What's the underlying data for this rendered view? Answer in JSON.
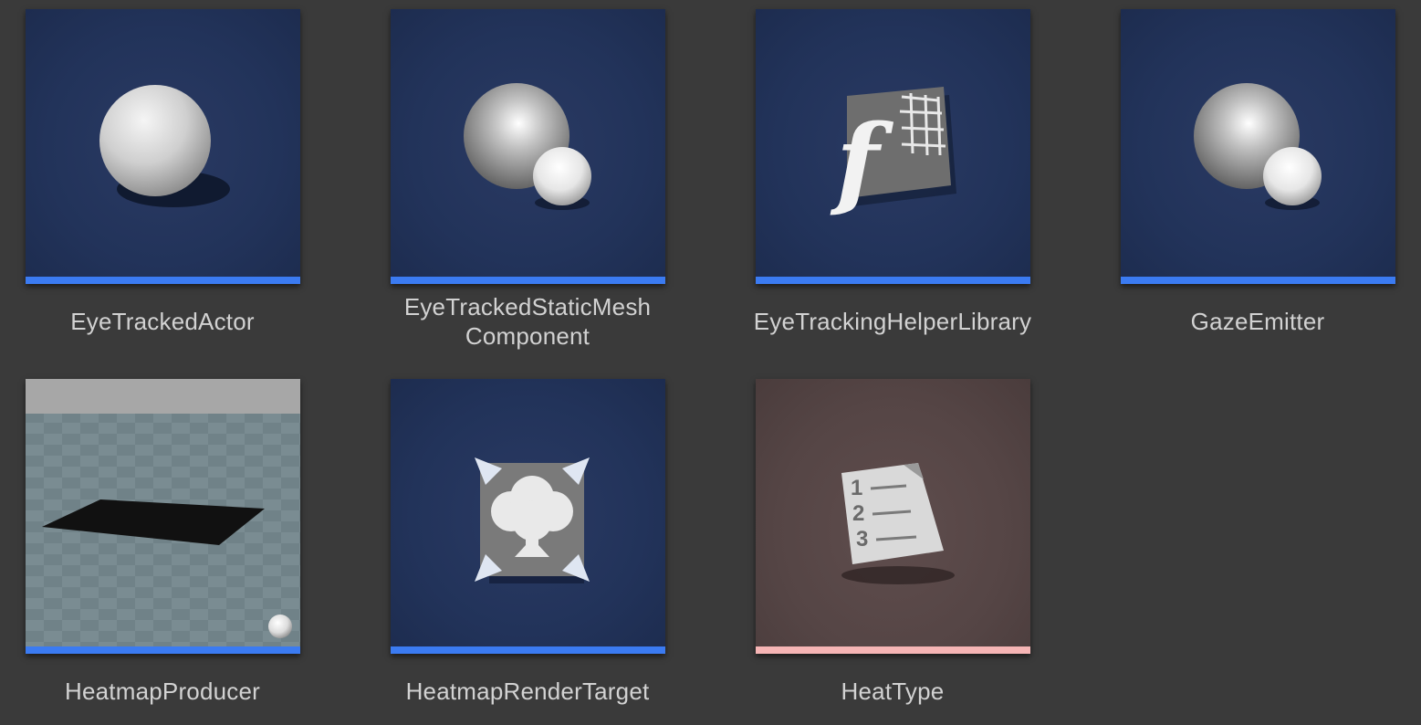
{
  "assets": [
    {
      "name": "EyeTrackedActor",
      "icon": "sphere-actor-icon",
      "type_color": "#3b7bf2",
      "thumb": "blue"
    },
    {
      "name_line1": "EyeTrackedStaticMesh",
      "name_line2": "Component",
      "icon": "component-spheres-icon",
      "type_color": "#3b7bf2",
      "thumb": "blue"
    },
    {
      "name": "EyeTrackingHelperLibrary",
      "icon": "function-library-icon",
      "type_color": "#3b7bf2",
      "thumb": "blue"
    },
    {
      "name": "GazeEmitter",
      "icon": "component-spheres-icon",
      "type_color": "#3b7bf2",
      "thumb": "blue"
    },
    {
      "name": "HeatmapProducer",
      "icon": "level-preview-thumbnail",
      "type_color": "#3b7bf2",
      "thumb": "scene"
    },
    {
      "name": "HeatmapRenderTarget",
      "icon": "render-target-icon",
      "type_color": "#3b7bf2",
      "thumb": "blue"
    },
    {
      "name": "HeatType",
      "icon": "enum-list-icon",
      "type_color": "#f6b5b5",
      "thumb": "brown"
    }
  ]
}
